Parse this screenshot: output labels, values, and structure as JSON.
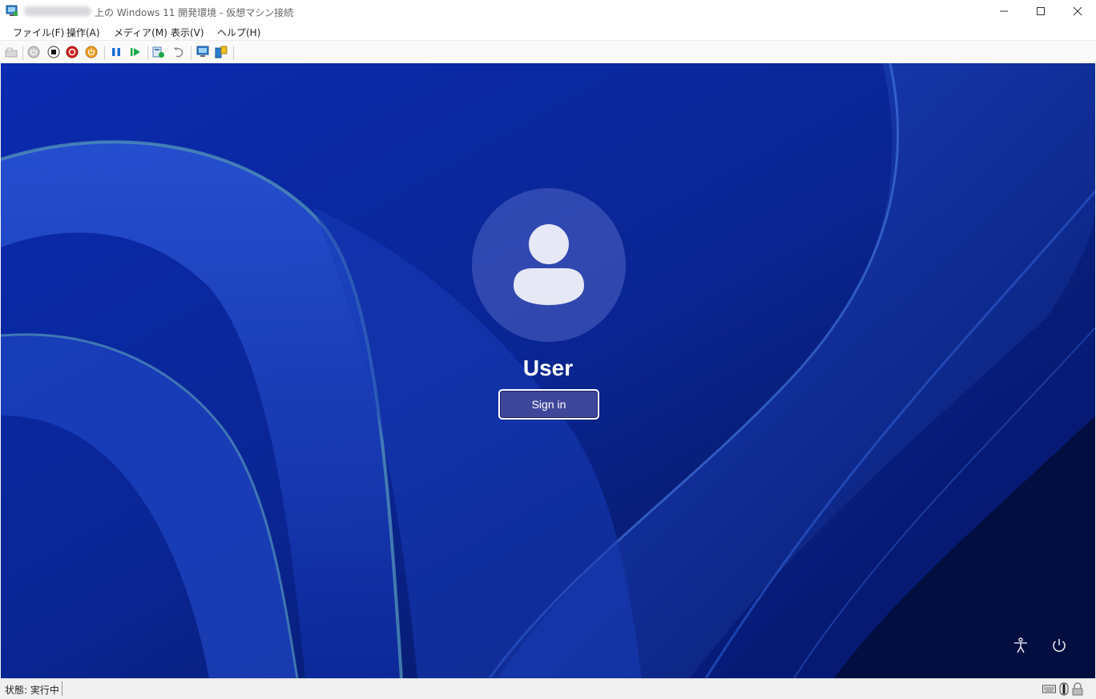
{
  "window": {
    "title": "上の Windows 11 開発環境 - 仮想マシン接続",
    "controls": {
      "minimize": "minimize",
      "maximize": "maximize",
      "close": "close"
    }
  },
  "menu": [
    "ファイル(F)",
    "操作(A)",
    "メディア(M)",
    "表示(V)",
    "ヘルプ(H)"
  ],
  "toolbar": {
    "icons": [
      "ctrl-alt-del-icon",
      "start-icon",
      "turn-off-icon",
      "shutdown-icon",
      "save-icon",
      "pause-icon",
      "resume-icon",
      "checkpoint-icon",
      "revert-icon",
      "enhanced-session-icon",
      "share-icon"
    ]
  },
  "lock_screen": {
    "user_name": "User",
    "sign_in_label": "Sign in",
    "accessibility_icon": "accessibility-icon",
    "power_icon": "power-icon"
  },
  "status_bar": {
    "status_text": "状態: 実行中",
    "icons": [
      "keyboard-icon",
      "mouse-icon",
      "lock-icon"
    ]
  },
  "colors": {
    "wallpaper_base": "#0a2a9a",
    "button_fill": "#3f479a",
    "accent_green": "#1aa84a",
    "accent_blue": "#1b6fd1"
  }
}
